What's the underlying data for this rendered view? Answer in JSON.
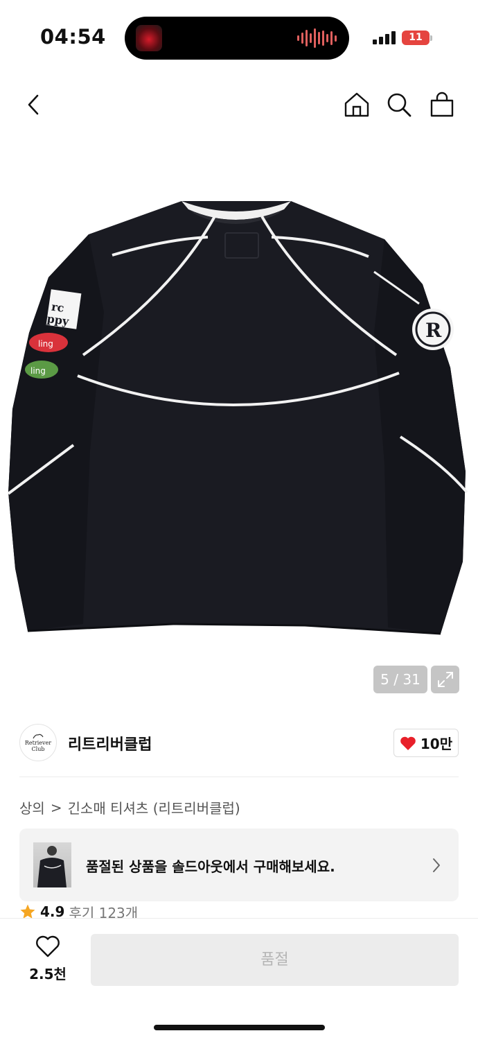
{
  "status_bar": {
    "time": "04:54",
    "battery": "11"
  },
  "gallery": {
    "counter": "5 / 31"
  },
  "brand": {
    "name": "리트리버클럽",
    "logo_text": [
      "Retriever",
      "Club"
    ],
    "likes": "10만"
  },
  "breadcrumb": {
    "category": "상의",
    "separator": ">",
    "subcategory": "긴소매 티셔츠 (리트리버클럽)"
  },
  "soldout_banner": {
    "text": "품절된 상품을 솔드아웃에서 구매해보세요."
  },
  "rating": {
    "score": "4.9",
    "reviews": "후기 123개"
  },
  "bottom_bar": {
    "wish_count": "2.5천",
    "buy_label": "품절"
  },
  "colors": {
    "heart": "#e8202a",
    "star": "#f5a623",
    "battery": "#e5443f",
    "buy_disabled_bg": "#ececec"
  },
  "icons": [
    "back-icon",
    "home-icon",
    "search-icon",
    "cart-icon",
    "expand-icon",
    "heart-icon",
    "chevron-right-icon",
    "star-icon"
  ]
}
